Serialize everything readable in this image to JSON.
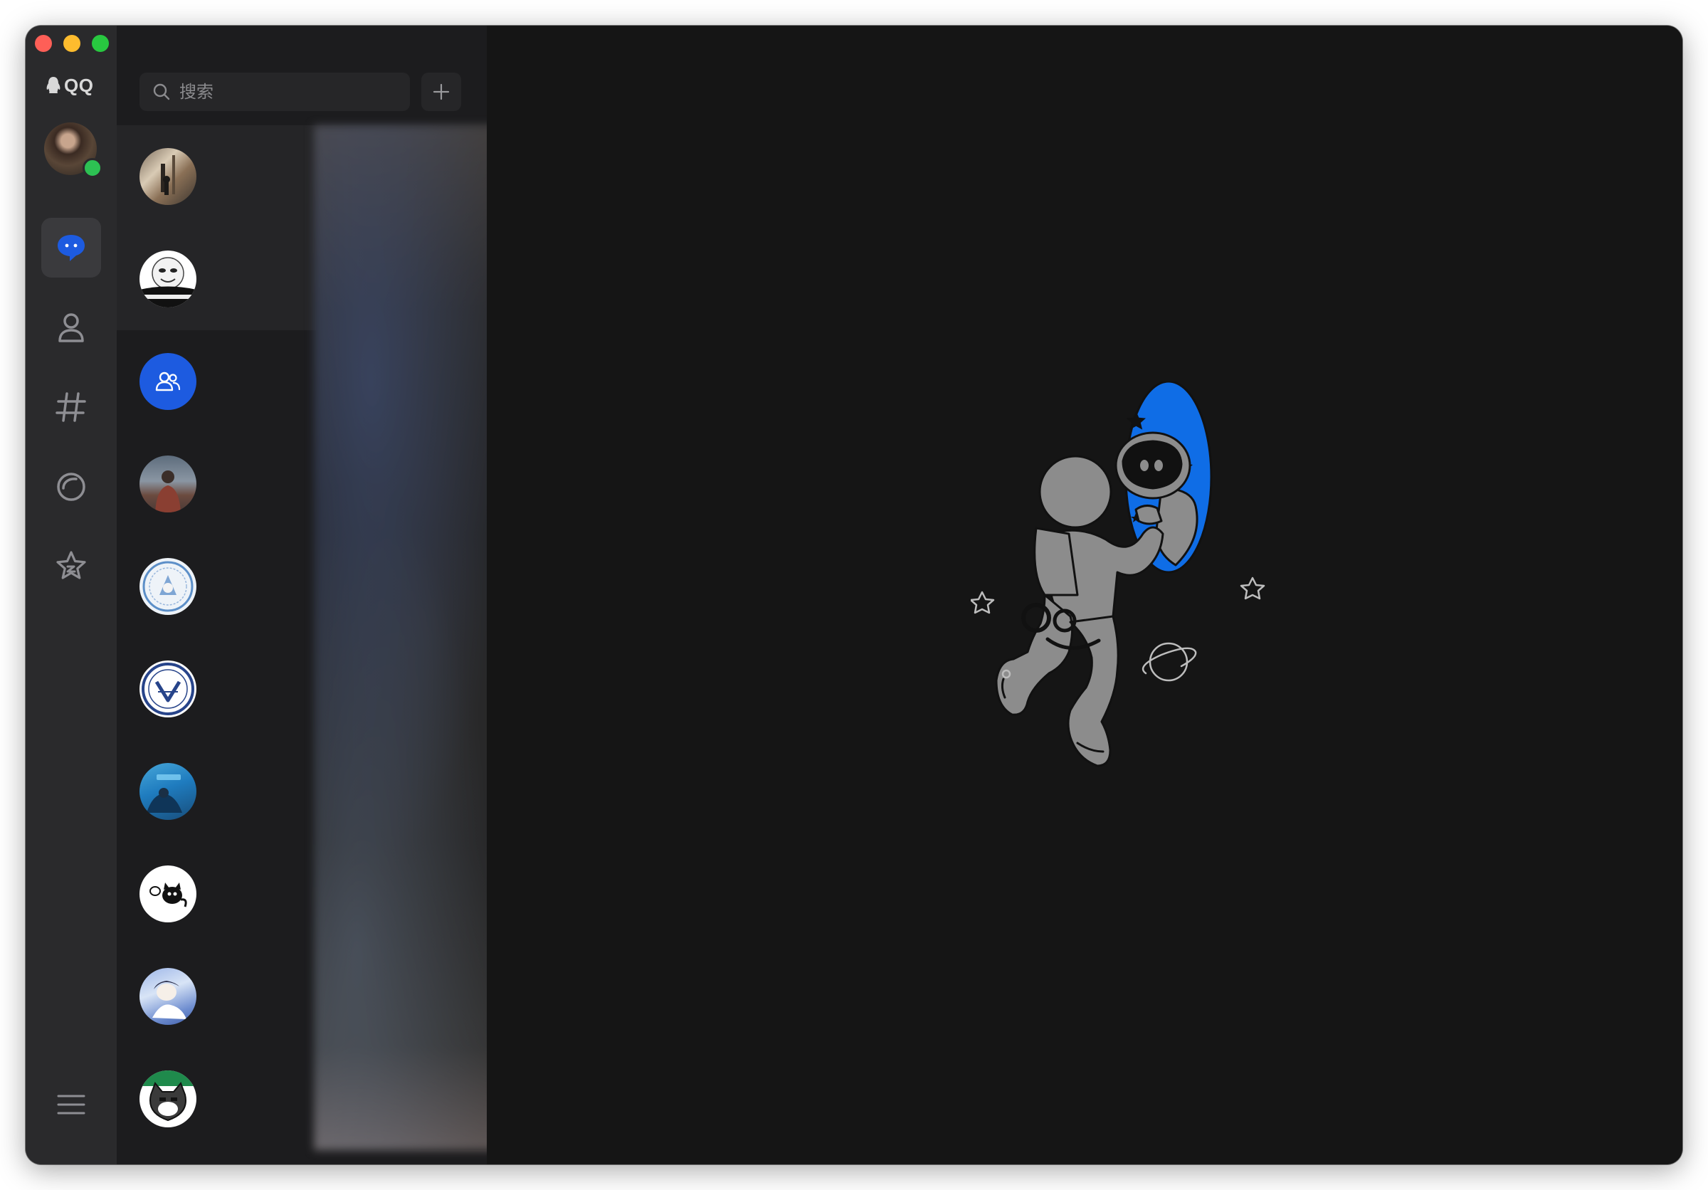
{
  "window": {
    "traffic_lights": [
      "close",
      "minimize",
      "zoom"
    ]
  },
  "rail": {
    "brand": "QQ",
    "status": "online",
    "nav_items": [
      {
        "id": "messages",
        "icon": "chat-bubble-icon",
        "active": true
      },
      {
        "id": "contacts",
        "icon": "person-icon",
        "active": false
      },
      {
        "id": "channels",
        "icon": "hashtag-icon",
        "active": false
      },
      {
        "id": "moments",
        "icon": "ring-icon",
        "active": false
      },
      {
        "id": "favorites",
        "icon": "star-icon",
        "active": false
      }
    ],
    "menu_icon": "hamburger-menu-icon"
  },
  "list": {
    "search_placeholder": "搜索",
    "add_icon": "plus-icon",
    "conversations": [
      {
        "avatar": "photo-street",
        "highlighted": true
      },
      {
        "avatar": "meme-face",
        "highlighted": true
      },
      {
        "avatar": "group-icon",
        "highlighted": false
      },
      {
        "avatar": "photo-person",
        "highlighted": false
      },
      {
        "avatar": "school-emblem",
        "highlighted": false
      },
      {
        "avatar": "college-seal",
        "highlighted": false
      },
      {
        "avatar": "blue-poster",
        "highlighted": false
      },
      {
        "avatar": "black-cat",
        "highlighted": false
      },
      {
        "avatar": "anime-girl",
        "highlighted": false
      },
      {
        "avatar": "pixel-cat",
        "highlighted": false
      }
    ]
  },
  "colors": {
    "accent": "#1d5be0",
    "online": "#2dc153",
    "rail_bg": "#2a2a2c",
    "list_bg": "#1c1c1e",
    "main_bg": "#151515",
    "illustration_blue": "#0f6de6"
  },
  "main": {
    "empty_state_illustration": "astronaut-portal"
  }
}
